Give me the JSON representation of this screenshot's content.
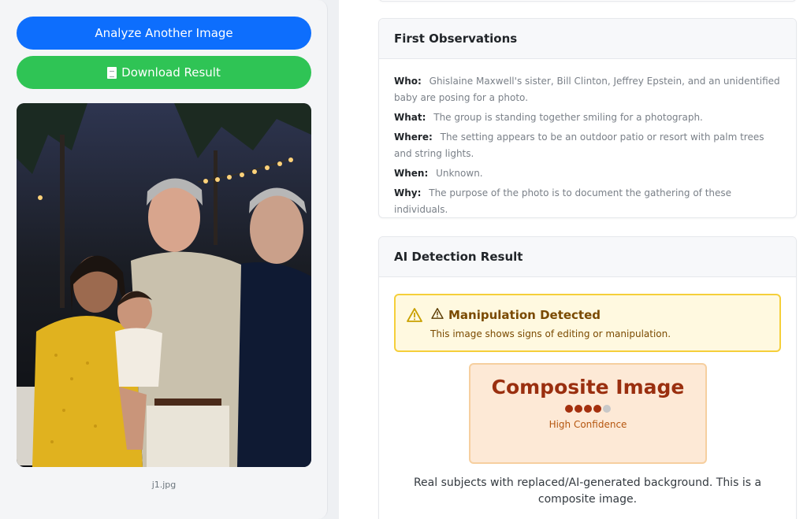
{
  "left": {
    "analyze_label": "Analyze Another Image",
    "download_label": "Download Result",
    "filename": "j1.jpg"
  },
  "observations": {
    "title": "First Observations",
    "rows": [
      {
        "label": "Who:",
        "value": "Ghislaine Maxwell's sister, Bill Clinton, Jeffrey Epstein, and an unidentified baby are posing for a photo."
      },
      {
        "label": "What:",
        "value": "The group is standing together smiling for a photograph."
      },
      {
        "label": "Where:",
        "value": "The setting appears to be an outdoor patio or resort with palm trees and string lights."
      },
      {
        "label": "When:",
        "value": "Unknown."
      },
      {
        "label": "Why:",
        "value": "The purpose of the photo is to document the gathering of these individuals."
      }
    ]
  },
  "ai_detection": {
    "title": "AI Detection Result",
    "alert_title": "Manipulation Detected",
    "alert_text": "This image shows signs of editing or manipulation.",
    "result_label": "Composite Image",
    "confidence_level": 4,
    "confidence_max": 5,
    "confidence_label": "High Confidence",
    "description": "Real subjects with replaced/AI-generated background. This is a composite image."
  },
  "colors": {
    "primary": "#0d6efd",
    "success": "#2fc455",
    "warning_border": "#f5cf3a",
    "result_text": "#9a2f0f"
  },
  "icons": [
    "document-icon",
    "warning-icon"
  ]
}
